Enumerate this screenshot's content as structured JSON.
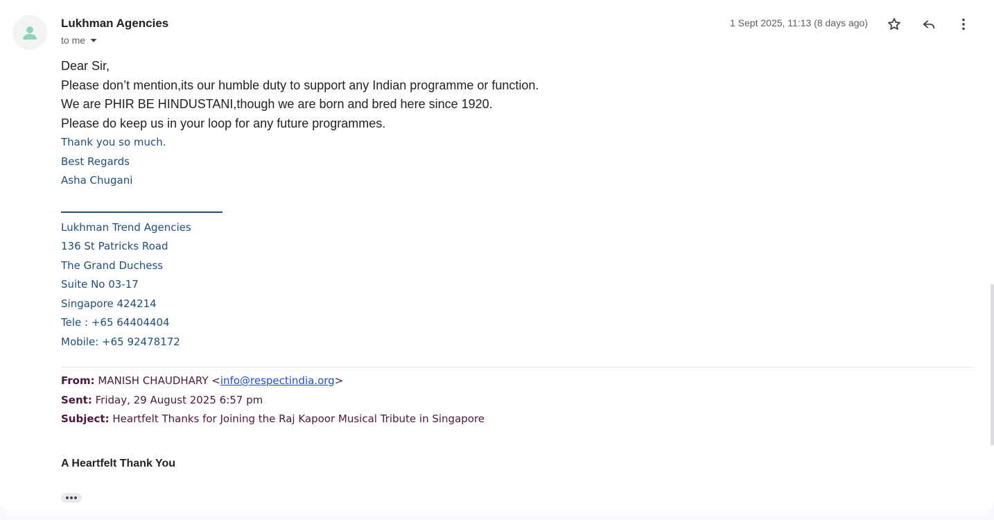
{
  "sender": {
    "name": "Lukhman Agencies",
    "recipient_label": "to me"
  },
  "date": "1 Sept 2025, 11:13 (8 days ago)",
  "body": {
    "lines": [
      "Dear Sir,",
      "Please don’t mention,its our humble duty to support any Indian programme or function.",
      "We are PHIR BE HINDUSTANI,though we are born and bred here since 1920.",
      "Please do keep us in your loop for any future programmes."
    ],
    "closing": [
      "Thank you so much.",
      "Best Regards",
      "Asha Chugani"
    ],
    "signature": [
      "Lukhman Trend Agencies",
      "136 St Patricks Road",
      "The Grand Duchess",
      "Suite No 03-17",
      "Singapore 424214",
      "Tele : +65 64404404",
      "Mobile: +65 92478172"
    ]
  },
  "quoted": {
    "from_label": "From:",
    "from_name": "MANISH CHAUDHARY <",
    "from_email": "info@respectindia.org",
    "from_close": ">",
    "sent_label": "Sent:",
    "sent_value": "Friday, 29 August 2025 6:57 pm",
    "subject_label": "Subject:",
    "subject_value": "Heartfelt Thanks for Joining the Raj Kapoor Musical Tribute in Singapore",
    "heading": "A Heartfelt Thank You"
  },
  "icons": {
    "avatar": "person-icon",
    "star": "star-icon",
    "reply": "reply-icon",
    "more": "more-vert-icon",
    "caret": "caret-down-icon",
    "ellipsis": "show-trimmed-content-icon"
  },
  "colors": {
    "signature_blue": "#1f4e79",
    "quoted_header": "#4a1740",
    "link": "#1a4fd6",
    "avatar_green": "#8dd4b6"
  }
}
